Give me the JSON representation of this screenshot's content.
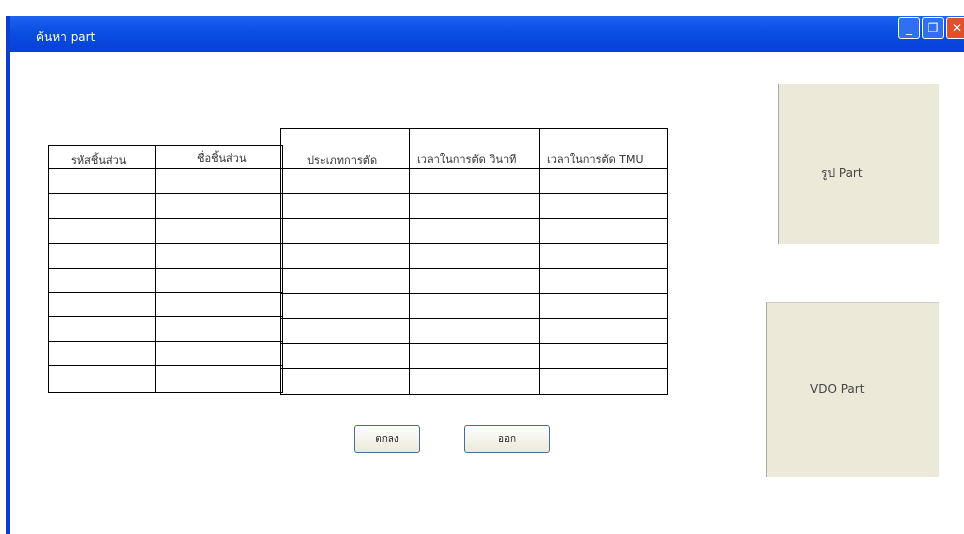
{
  "window": {
    "title": "ค้นหา part"
  },
  "table": {
    "headers": [
      "รหัสชิ้นส่วน",
      "ชื่อชิ้นส่วน",
      "ประเภทการตัด",
      "เวลาในการตัด วินาที",
      "เวลาในการตัด TMU"
    ],
    "row_count": 9
  },
  "buttons": {
    "ok": "ตกลง",
    "exit": "ออก"
  },
  "panels": {
    "photo": "รูป Part",
    "video": "VDO Part"
  }
}
